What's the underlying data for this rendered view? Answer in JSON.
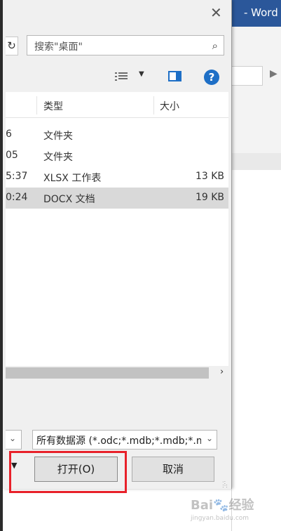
{
  "word": {
    "title": "- Word"
  },
  "dialog": {
    "close_glyph": "✕",
    "refresh_glyph": "↻",
    "search_placeholder": "搜索\"桌面\"",
    "search_icon_glyph": "⌕",
    "help_glyph": "?",
    "columns": {
      "type": "类型",
      "size": "大小"
    },
    "files": [
      {
        "time": "6",
        "type": "文件夹",
        "size": ""
      },
      {
        "time": "05",
        "type": "文件夹",
        "size": ""
      },
      {
        "time": "5:37",
        "type": "XLSX 工作表",
        "size": "13 KB"
      },
      {
        "time": "0:24",
        "type": "DOCX 文档",
        "size": "19 KB",
        "selected": true
      }
    ],
    "scroll_right_glyph": "›",
    "file_type_filter": "所有数据源 (*.odc;*.mdb;*.mdb;*.mc",
    "filter_arrow_glyph": "⌄",
    "tools_arrow_glyph": "▼",
    "open_label": "打开(O)",
    "cancel_label": "取消"
  },
  "watermark": {
    "text": "Bai🐾经验",
    "sub": "jingyan.baidu.com"
  }
}
